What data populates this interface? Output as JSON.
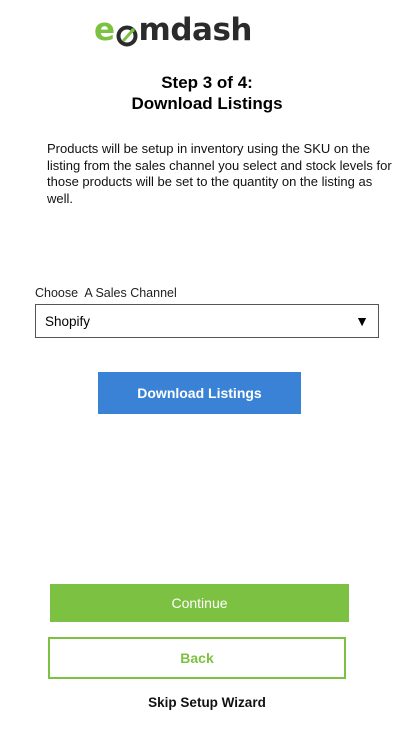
{
  "brand": {
    "logo_first": "e",
    "logo_rest": "mdash",
    "logo_accent_color": "#7cc142",
    "logo_text_color": "#2b2b2b"
  },
  "header": {
    "step_label": "Step 3 of 4:",
    "step_title": "Download Listings"
  },
  "description": "Products will be setup in inventory using the SKU on the listing from the sales channel you select and stock levels for those products will be set to the quantity on the listing as well.",
  "sales_channel": {
    "label": "Choose  A Sales Channel",
    "selected": "Shopify",
    "arrow_icon": "triangle-down-icon"
  },
  "actions": {
    "download_label": "Download Listings",
    "download_color": "#3a82d6",
    "continue_label": "Continue",
    "back_label": "Back",
    "skip_label": "Skip Setup Wizard",
    "primary_color": "#7cc142"
  }
}
